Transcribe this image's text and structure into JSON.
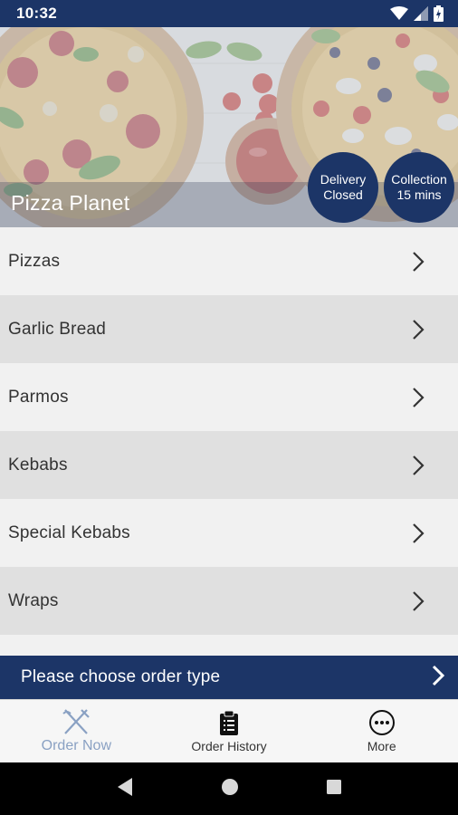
{
  "status_bar": {
    "time": "10:32",
    "icons": [
      "wifi-icon",
      "signal-icon",
      "battery-icon"
    ]
  },
  "restaurant": {
    "name": "Pizza Planet"
  },
  "badges": {
    "delivery": {
      "line1": "Delivery",
      "line2": "Closed"
    },
    "collection": {
      "line1": "Collection",
      "line2": "15 mins"
    }
  },
  "menu": {
    "categories": [
      {
        "label": "Pizzas"
      },
      {
        "label": "Garlic Bread"
      },
      {
        "label": "Parmos"
      },
      {
        "label": "Kebabs"
      },
      {
        "label": "Special Kebabs"
      },
      {
        "label": "Wraps"
      }
    ]
  },
  "order_bar": {
    "label": "Please choose order type"
  },
  "tabs": [
    {
      "label": "Order Now",
      "icon": "fork-knife-icon",
      "active": true
    },
    {
      "label": "Order History",
      "icon": "clipboard-icon",
      "active": false
    },
    {
      "label": "More",
      "icon": "more-icon",
      "active": false
    }
  ],
  "nav": {
    "icons": [
      "back-icon",
      "home-icon",
      "recents-icon"
    ]
  },
  "colors": {
    "primary": "#1c3567",
    "active_tab": "#8aa1c3",
    "row_alt": "#e0e0e0",
    "row": "#f1f1f1"
  }
}
